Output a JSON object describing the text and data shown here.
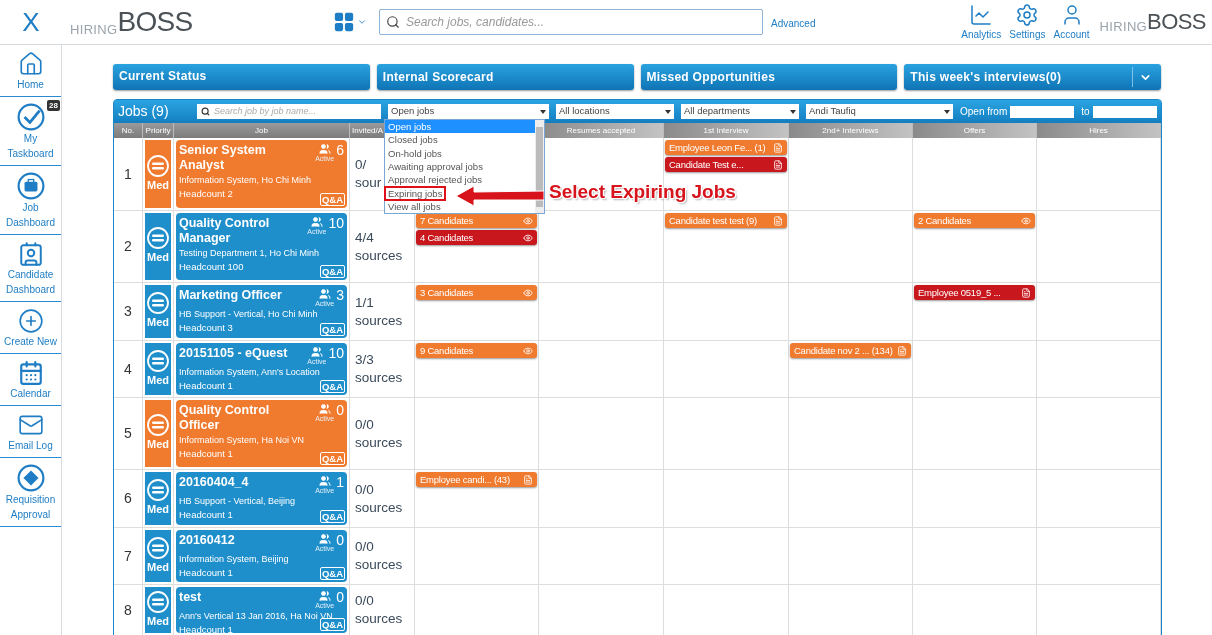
{
  "topbar": {
    "close": "X",
    "logo": {
      "light": "HIRING",
      "bold": "BOSS"
    },
    "search": {
      "placeholder": "Search jobs, candidates..."
    },
    "advanced": "Advanced",
    "actions": [
      {
        "kind": "analytics",
        "label": "Analytics"
      },
      {
        "kind": "settings",
        "label": "Settings"
      },
      {
        "kind": "account",
        "label": "Account"
      }
    ],
    "logo_right": {
      "light": "HIRING",
      "bold": "BOSS"
    }
  },
  "sidebar": {
    "items": [
      {
        "kind": "home",
        "label": "Home"
      },
      {
        "kind": "taskboard",
        "label": "My Taskboard",
        "badge": "28"
      },
      {
        "kind": "job",
        "label": "Job Dashboard"
      },
      {
        "kind": "candidate",
        "label": "Candidate Dashboard"
      },
      {
        "kind": "create",
        "label": "Create New"
      },
      {
        "kind": "calendar",
        "label": "Calendar"
      },
      {
        "kind": "email",
        "label": "Email Log"
      },
      {
        "kind": "requisition",
        "label": "Requisition Approval"
      }
    ]
  },
  "panels": [
    {
      "label": "Current Status",
      "expand": false
    },
    {
      "label": "Internal Scorecard",
      "expand": false
    },
    {
      "label": "Missed Opportunities",
      "expand": false
    },
    {
      "label": "This week's interviews(0)",
      "expand": true
    }
  ],
  "jobs": {
    "title": "Jobs (9)",
    "search": {
      "placeholder": "Search job by job name..."
    },
    "filters": [
      {
        "value": "Open jobs"
      },
      {
        "value": "All locations"
      },
      {
        "value": "All departments"
      },
      {
        "value": "Andi Taufiq"
      }
    ],
    "open_from": "Open from",
    "to": "to",
    "dropdown": {
      "options": [
        {
          "label": "Open jobs",
          "selected": true,
          "annotated": false
        },
        {
          "label": "Closed jobs",
          "selected": false,
          "annotated": false
        },
        {
          "label": "On-hold jobs",
          "selected": false,
          "annotated": false
        },
        {
          "label": "Awaiting approval jobs",
          "selected": false,
          "annotated": false
        },
        {
          "label": "Approval rejected jobs",
          "selected": false,
          "annotated": false
        },
        {
          "label": "Expiring jobs",
          "selected": false,
          "annotated": true
        },
        {
          "label": "View all jobs",
          "selected": false,
          "annotated": false
        }
      ]
    },
    "columns": [
      "No.",
      "Priority",
      "Job",
      "Invited/A",
      "Resumes accepted",
      "1st Interview",
      "2nd+ Interviews",
      "Offers",
      "Hires"
    ],
    "rows": [
      {
        "no": "1",
        "color": "#f07a2e",
        "priority": "Med",
        "title": "Senior System Analyst",
        "location": "Information System, Ho Chi Minh",
        "headcount": "Headcount 2",
        "active": "6",
        "active_label": "Active",
        "qa": "Q&A",
        "invited": "0/",
        "sources": "sour",
        "stages": {
          "interview_1": [
            {
              "kind": "name",
              "label": "Employee Leon Fe... (1)",
              "color": "#f07a2e"
            },
            {
              "kind": "name",
              "label": "Candidate Test e...",
              "color": "#c8171d"
            }
          ]
        }
      },
      {
        "no": "2",
        "color": "#1f8fcb",
        "priority": "Med",
        "title": "Quality Control Manager",
        "location": "Testing Department 1, Ho Chi Minh",
        "headcount": "Headcount 100",
        "active": "10",
        "active_label": "Active",
        "qa": "Q&A",
        "invited": "4/4",
        "sources": "sources",
        "stages": {
          "applied": [
            {
              "kind": "count",
              "label": "7 Candidates",
              "color": "#f07a2e"
            },
            {
              "kind": "count",
              "label": "4 Candidates",
              "color": "#c8171d"
            }
          ],
          "interview_1": [
            {
              "kind": "name",
              "label": "Candidate test test (9)",
              "color": "#f07a2e"
            }
          ],
          "offers": [
            {
              "kind": "count",
              "label": "2 Candidates",
              "color": "#f07a2e"
            }
          ]
        }
      },
      {
        "no": "3",
        "color": "#1f8fcb",
        "priority": "Med",
        "title": "Marketing Officer",
        "location": "HB Support - Vertical, Ho Chi Minh",
        "headcount": "Headcount 3",
        "active": "3",
        "active_label": "Active",
        "qa": "Q&A",
        "invited": "1/1",
        "sources": "sources",
        "stages": {
          "applied": [
            {
              "kind": "count",
              "label": "3 Candidates",
              "color": "#f07a2e"
            }
          ],
          "offers": [
            {
              "kind": "name",
              "label": "Employee 0519_5 ...",
              "color": "#c8171d"
            }
          ]
        }
      },
      {
        "no": "4",
        "color": "#1f8fcb",
        "priority": "Med",
        "title": "20151105 - eQuest",
        "location": "Information System, Ann's Location",
        "headcount": "Headcount 1",
        "active": "10",
        "active_label": "Active",
        "qa": "Q&A",
        "invited": "3/3",
        "sources": "sources",
        "stages": {
          "applied": [
            {
              "kind": "count",
              "label": "9 Candidates",
              "color": "#f07a2e"
            }
          ],
          "interview_2": [
            {
              "kind": "name",
              "label": "Candidate nov 2 ... (134)",
              "color": "#f07a2e"
            }
          ]
        }
      },
      {
        "no": "5",
        "color": "#f07a2e",
        "priority": "Med",
        "title": "Quality Control Officer",
        "location": "Information System, Ha Noi VN",
        "headcount": "Headcount 1",
        "active": "0",
        "active_label": "Active",
        "qa": "Q&A",
        "invited": "0/0",
        "sources": "sources"
      },
      {
        "no": "6",
        "color": "#1f8fcb",
        "priority": "Med",
        "title": "20160404_4",
        "location": "HB Support - Vertical, Beijing",
        "headcount": "Headcount 1",
        "active": "1",
        "active_label": "Active",
        "qa": "Q&A",
        "invited": "0/0",
        "sources": "sources",
        "stages": {
          "applied": [
            {
              "kind": "name",
              "label": "Employee candi... (43)",
              "color": "#f07a2e"
            }
          ]
        }
      },
      {
        "no": "7",
        "color": "#1f8fcb",
        "priority": "Med",
        "title": "20160412",
        "location": "Information System, Beijing",
        "headcount": "Headcount 1",
        "active": "0",
        "active_label": "Active",
        "qa": "Q&A",
        "invited": "0/0",
        "sources": "sources"
      },
      {
        "no": "8",
        "color": "#1f8fcb",
        "priority": "Med",
        "title": "test",
        "location": "Ann's Vertical 13 Jan 2016, Ha Noi VN",
        "headcount": "Headcount 1",
        "active": "0",
        "active_label": "Active",
        "qa": "Q&A",
        "invited": "0/0",
        "sources": "sources"
      }
    ]
  },
  "annotation": {
    "text": "Select Expiring Jobs"
  }
}
